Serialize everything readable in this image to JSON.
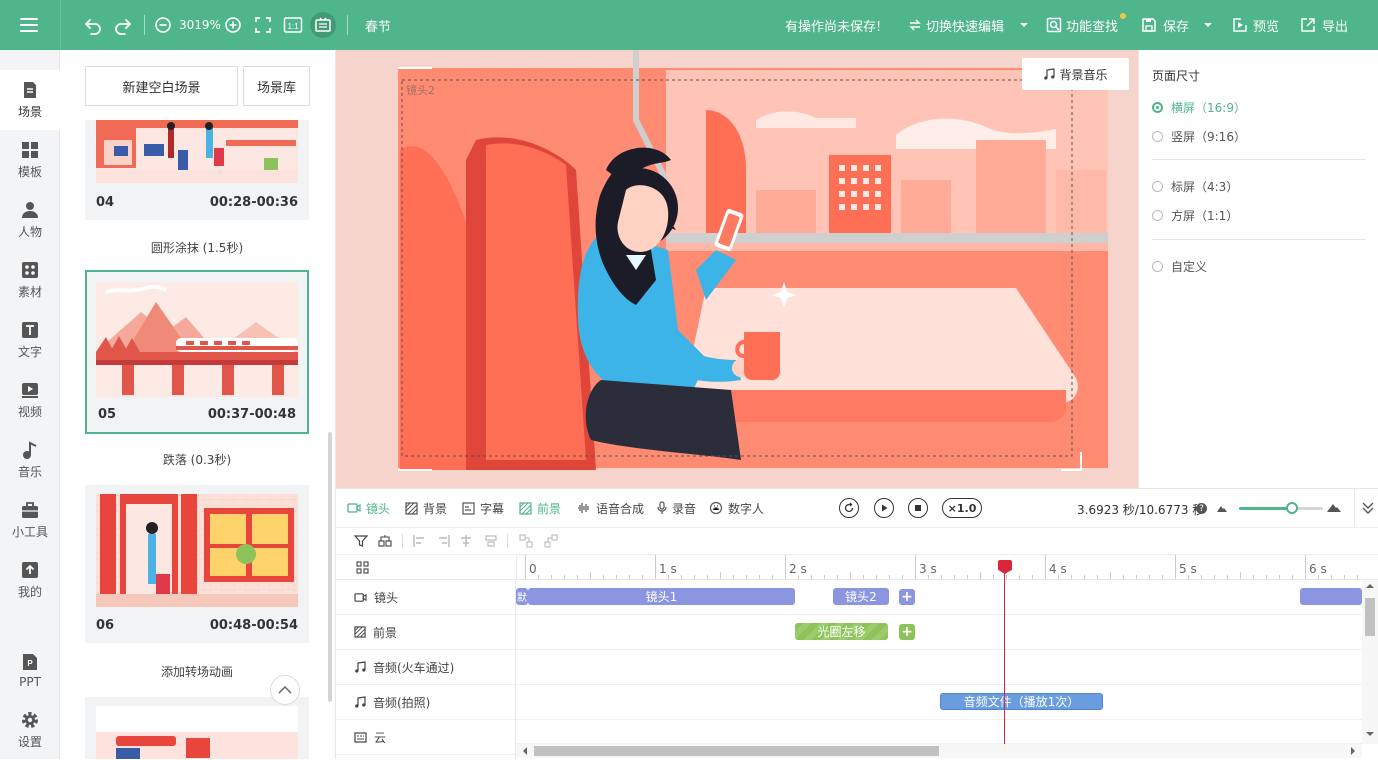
{
  "header": {
    "zoom": "3019%",
    "project_name": "春节",
    "unsaved_notice": "有操作尚未保存!",
    "quick_edit": "切换快速编辑",
    "feature_search": "功能查找",
    "save": "保存",
    "preview": "预览",
    "export": "导出",
    "accent_color": "#4fb58a"
  },
  "nav": [
    {
      "label": "场景",
      "icon": "scene-icon"
    },
    {
      "label": "模板",
      "icon": "template-icon"
    },
    {
      "label": "人物",
      "icon": "person-icon"
    },
    {
      "label": "素材",
      "icon": "material-icon"
    },
    {
      "label": "文字",
      "icon": "text-icon"
    },
    {
      "label": "视频",
      "icon": "video-icon"
    },
    {
      "label": "音乐",
      "icon": "music-icon"
    },
    {
      "label": "小工具",
      "icon": "toolbox-icon"
    },
    {
      "label": "我的",
      "icon": "upload-icon"
    },
    {
      "label": "PPT",
      "icon": "ppt-icon"
    },
    {
      "label": "设置",
      "icon": "settings-icon"
    }
  ],
  "scene_panel": {
    "new_blank": "新建空白场景",
    "library": "场景库",
    "scenes": [
      {
        "no": "04",
        "time": "00:28-00:36",
        "transition": "圆形涂抹 (1.5秒)"
      },
      {
        "no": "05",
        "time": "00:37-00:48",
        "transition": "跌落 (0.3秒)"
      },
      {
        "no": "06",
        "time": "00:48-00:54",
        "transition": "添加转场动画"
      }
    ]
  },
  "canvas": {
    "lens_label": "镜头2",
    "bg_music": "背景音乐"
  },
  "page_size": {
    "title": "页面尺寸",
    "options": [
      "横屏（16:9）",
      "竖屏（9:16）",
      "标屏（4:3）",
      "方屏（1:1）",
      "自定义"
    ],
    "selected": 0
  },
  "timeline": {
    "tabs": [
      "镜头",
      "背景",
      "字幕",
      "前景",
      "语音合成",
      "录音",
      "数字人"
    ],
    "active_tab": 3,
    "speed": "×1.0",
    "time_display": "3.6923 秒/10.6773 秒",
    "ruler": [
      "0",
      "1 s",
      "2 s",
      "3 s",
      "4 s",
      "5 s",
      "6 s"
    ],
    "tracks": [
      {
        "label": "镜头",
        "icon": "camera-icon"
      },
      {
        "label": "前景",
        "icon": "foreground-icon"
      },
      {
        "label": "音频(火车通过)",
        "icon": "audio-icon"
      },
      {
        "label": "音频(拍照)",
        "icon": "audio-icon"
      },
      {
        "label": "云",
        "icon": "image-icon"
      }
    ],
    "clips": {
      "default_tag": "默",
      "lens1": "镜头1",
      "lens2": "镜头2",
      "foreground1": "光圈左移",
      "audio_photo": "音频文件（播放1次）",
      "plus": "+"
    },
    "playhead_seconds": 3.6923,
    "total_seconds": 10.6773,
    "clip_colors": {
      "lens": "#8c95e0",
      "foreground": "#8cc35a",
      "audio": "#6a9ce0",
      "playhead": "#d8263a"
    }
  }
}
